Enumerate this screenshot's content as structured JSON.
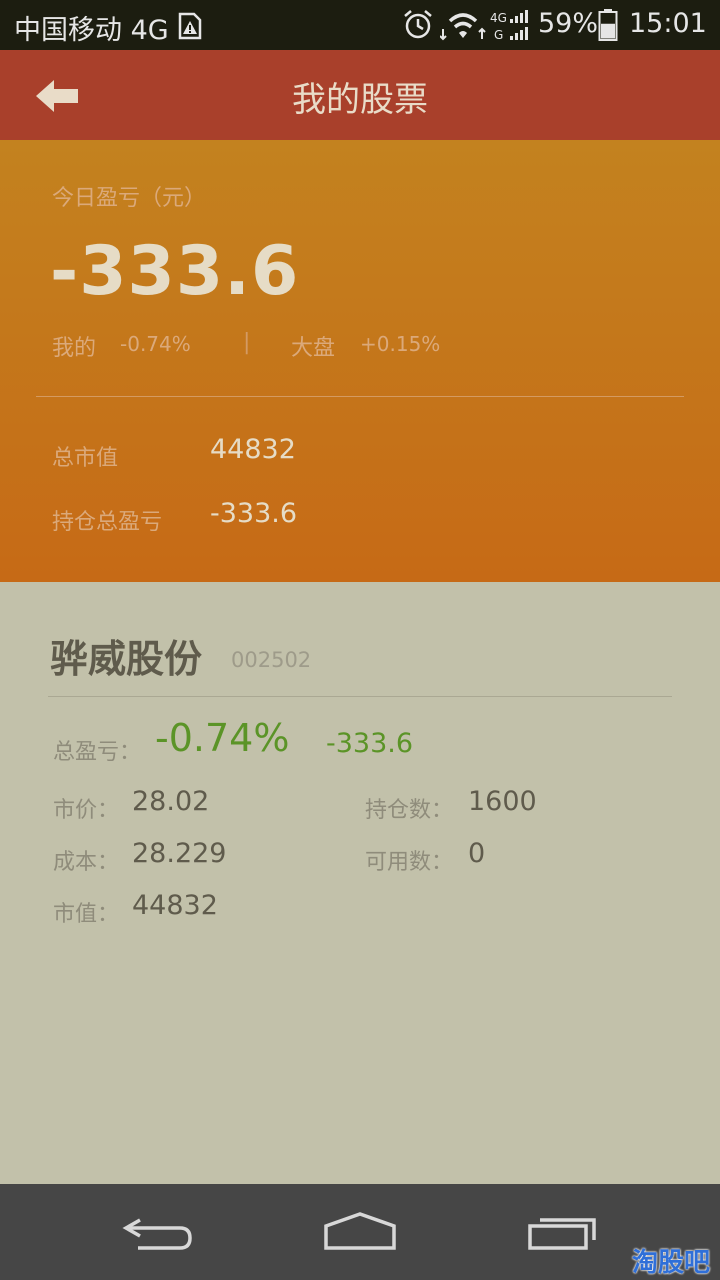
{
  "status_bar": {
    "carrier": "中国移动 4G",
    "battery": "59%",
    "time": "15:01",
    "icons": [
      "sim-warning-icon",
      "alarm-icon",
      "wifi-icon",
      "signal-4g-icon",
      "battery-icon"
    ],
    "battery_level": 0.59
  },
  "title_bar": {
    "title": "我的股票",
    "back_icon": "back-arrow-icon"
  },
  "summary": {
    "today_label": "今日盈亏（元）",
    "today_value": "-333.6",
    "mine_label": "我的",
    "mine_value": "-0.74%",
    "separator": "|",
    "market_label": "大盘",
    "market_value": "+0.15%",
    "market_cap_label": "总市值",
    "market_cap_value": "44832",
    "position_pnl_label": "持仓总盈亏",
    "position_pnl_value": "-333.6"
  },
  "stock": {
    "name": "骅威股份",
    "code": "002502",
    "total_pnl_label": "总盈亏：",
    "total_pnl_percent": "-0.74%",
    "total_pnl_amount": "-333.6",
    "price_label": "市价：",
    "price_value": "28.02",
    "holding_label": "持仓数：",
    "holding_value": "1600",
    "cost_label": "成本：",
    "cost_value": "28.229",
    "available_label": "可用数：",
    "available_value": "0",
    "market_value_label": "市值：",
    "market_value_value": "44832"
  },
  "nav_bar": {
    "icons": [
      "back-icon",
      "home-icon",
      "recent-apps-icon"
    ],
    "watermark": "淘股吧"
  },
  "colors": {
    "title_bar": "#a9402b",
    "summary_top": "#c3821f",
    "summary_bottom": "#c66a16",
    "card_bg": "#c2c1aa",
    "gain_loss_green": "#5b9427",
    "nav_bar": "#464646"
  }
}
